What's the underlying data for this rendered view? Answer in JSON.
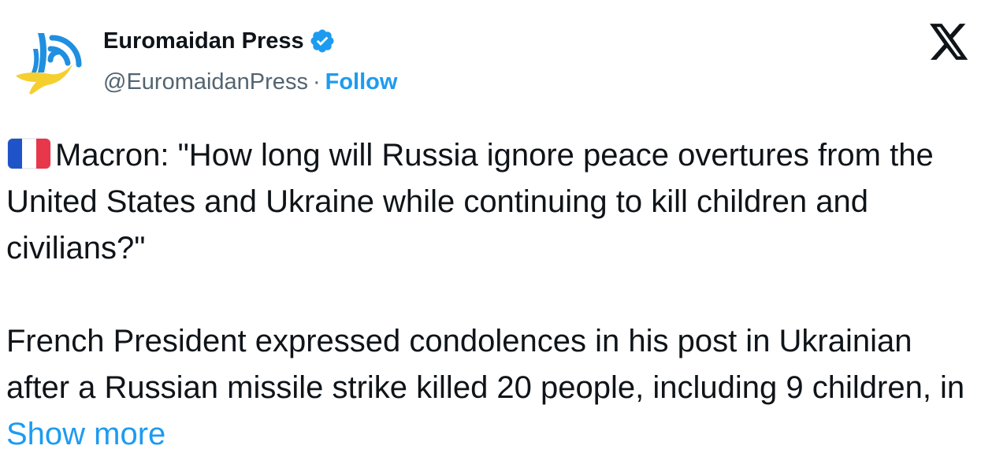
{
  "author": {
    "display_name": "Euromaidan Press",
    "handle": "@EuromaidanPress",
    "separator": "·",
    "follow_label": "Follow",
    "verified": true,
    "avatar_icon": "euromaidan-press-logo"
  },
  "platform_icon": "x-logo-icon",
  "tweet": {
    "flag_icon": "france-flag-emoji",
    "paragraph1": "Macron: \"How long will Russia ignore peace overtures from the United States and Ukraine while continuing to kill children and civilians?\"",
    "paragraph2": "French President expressed condolences in his post in Ukrainian after a Russian missile strike killed 20 people, including 9 children, in ",
    "show_more_label": "Show more"
  },
  "colors": {
    "text_primary": "#0f1419",
    "text_secondary": "#536471",
    "link_blue": "#1d9bf0",
    "flag_blue": "#1f54c9",
    "flag_red": "#e8364a",
    "logo_blue": "#1f8fe0",
    "logo_yellow": "#f5cf2e"
  }
}
